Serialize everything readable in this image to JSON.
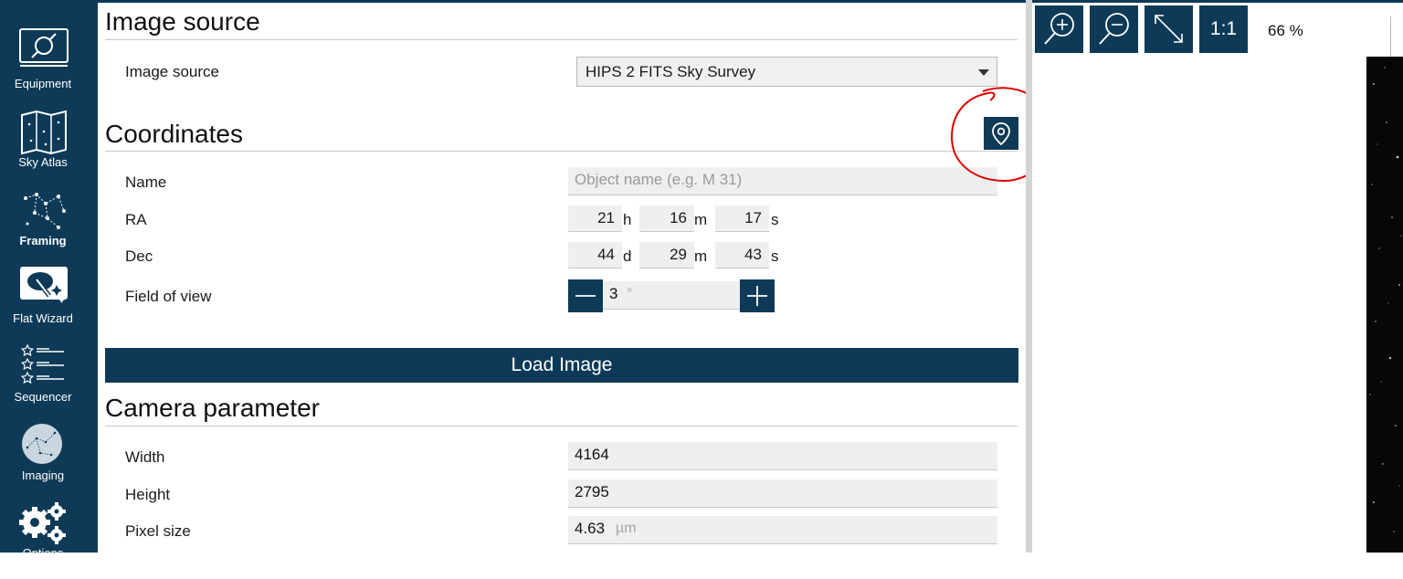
{
  "sidebar": {
    "items": [
      {
        "label": "Equipment",
        "icon": "plug-icon"
      },
      {
        "label": "Sky Atlas",
        "icon": "star-map-icon"
      },
      {
        "label": "Framing",
        "icon": "constellation-icon",
        "active": true
      },
      {
        "label": "Flat Wizard",
        "icon": "flat-panel-icon"
      },
      {
        "label": "Sequencer",
        "icon": "list-stars-icon"
      },
      {
        "label": "Imaging",
        "icon": "telescope-view-icon"
      },
      {
        "label": "Options",
        "icon": "gears-icon"
      }
    ]
  },
  "image_source": {
    "title": "Image source",
    "label": "Image source",
    "selected": "HIPS 2 FITS Sky Survey"
  },
  "coordinates": {
    "title": "Coordinates",
    "name_label": "Name",
    "name_placeholder": "Object name (e.g. M 31)",
    "ra_label": "RA",
    "ra": {
      "h": "21",
      "m": "16",
      "s": "17"
    },
    "dec_label": "Dec",
    "dec": {
      "d": "44",
      "m": "29",
      "s": "43"
    },
    "fov_label": "Field of view",
    "fov": "3",
    "fov_unit": "°",
    "units": {
      "h": "h",
      "d": "d",
      "m": "m",
      "s": "s"
    }
  },
  "load_button": "Load Image",
  "camera": {
    "title": "Camera parameter",
    "width_label": "Width",
    "width": "4164",
    "height_label": "Height",
    "height": "2795",
    "pixel_label": "Pixel size",
    "pixel": "4.63",
    "pixel_unit": "µm"
  },
  "toolbar": {
    "one_to_one": "1:1",
    "zoom": "66 %"
  },
  "colors": {
    "accent": "#0e3a57",
    "annotation": "#e00000"
  }
}
